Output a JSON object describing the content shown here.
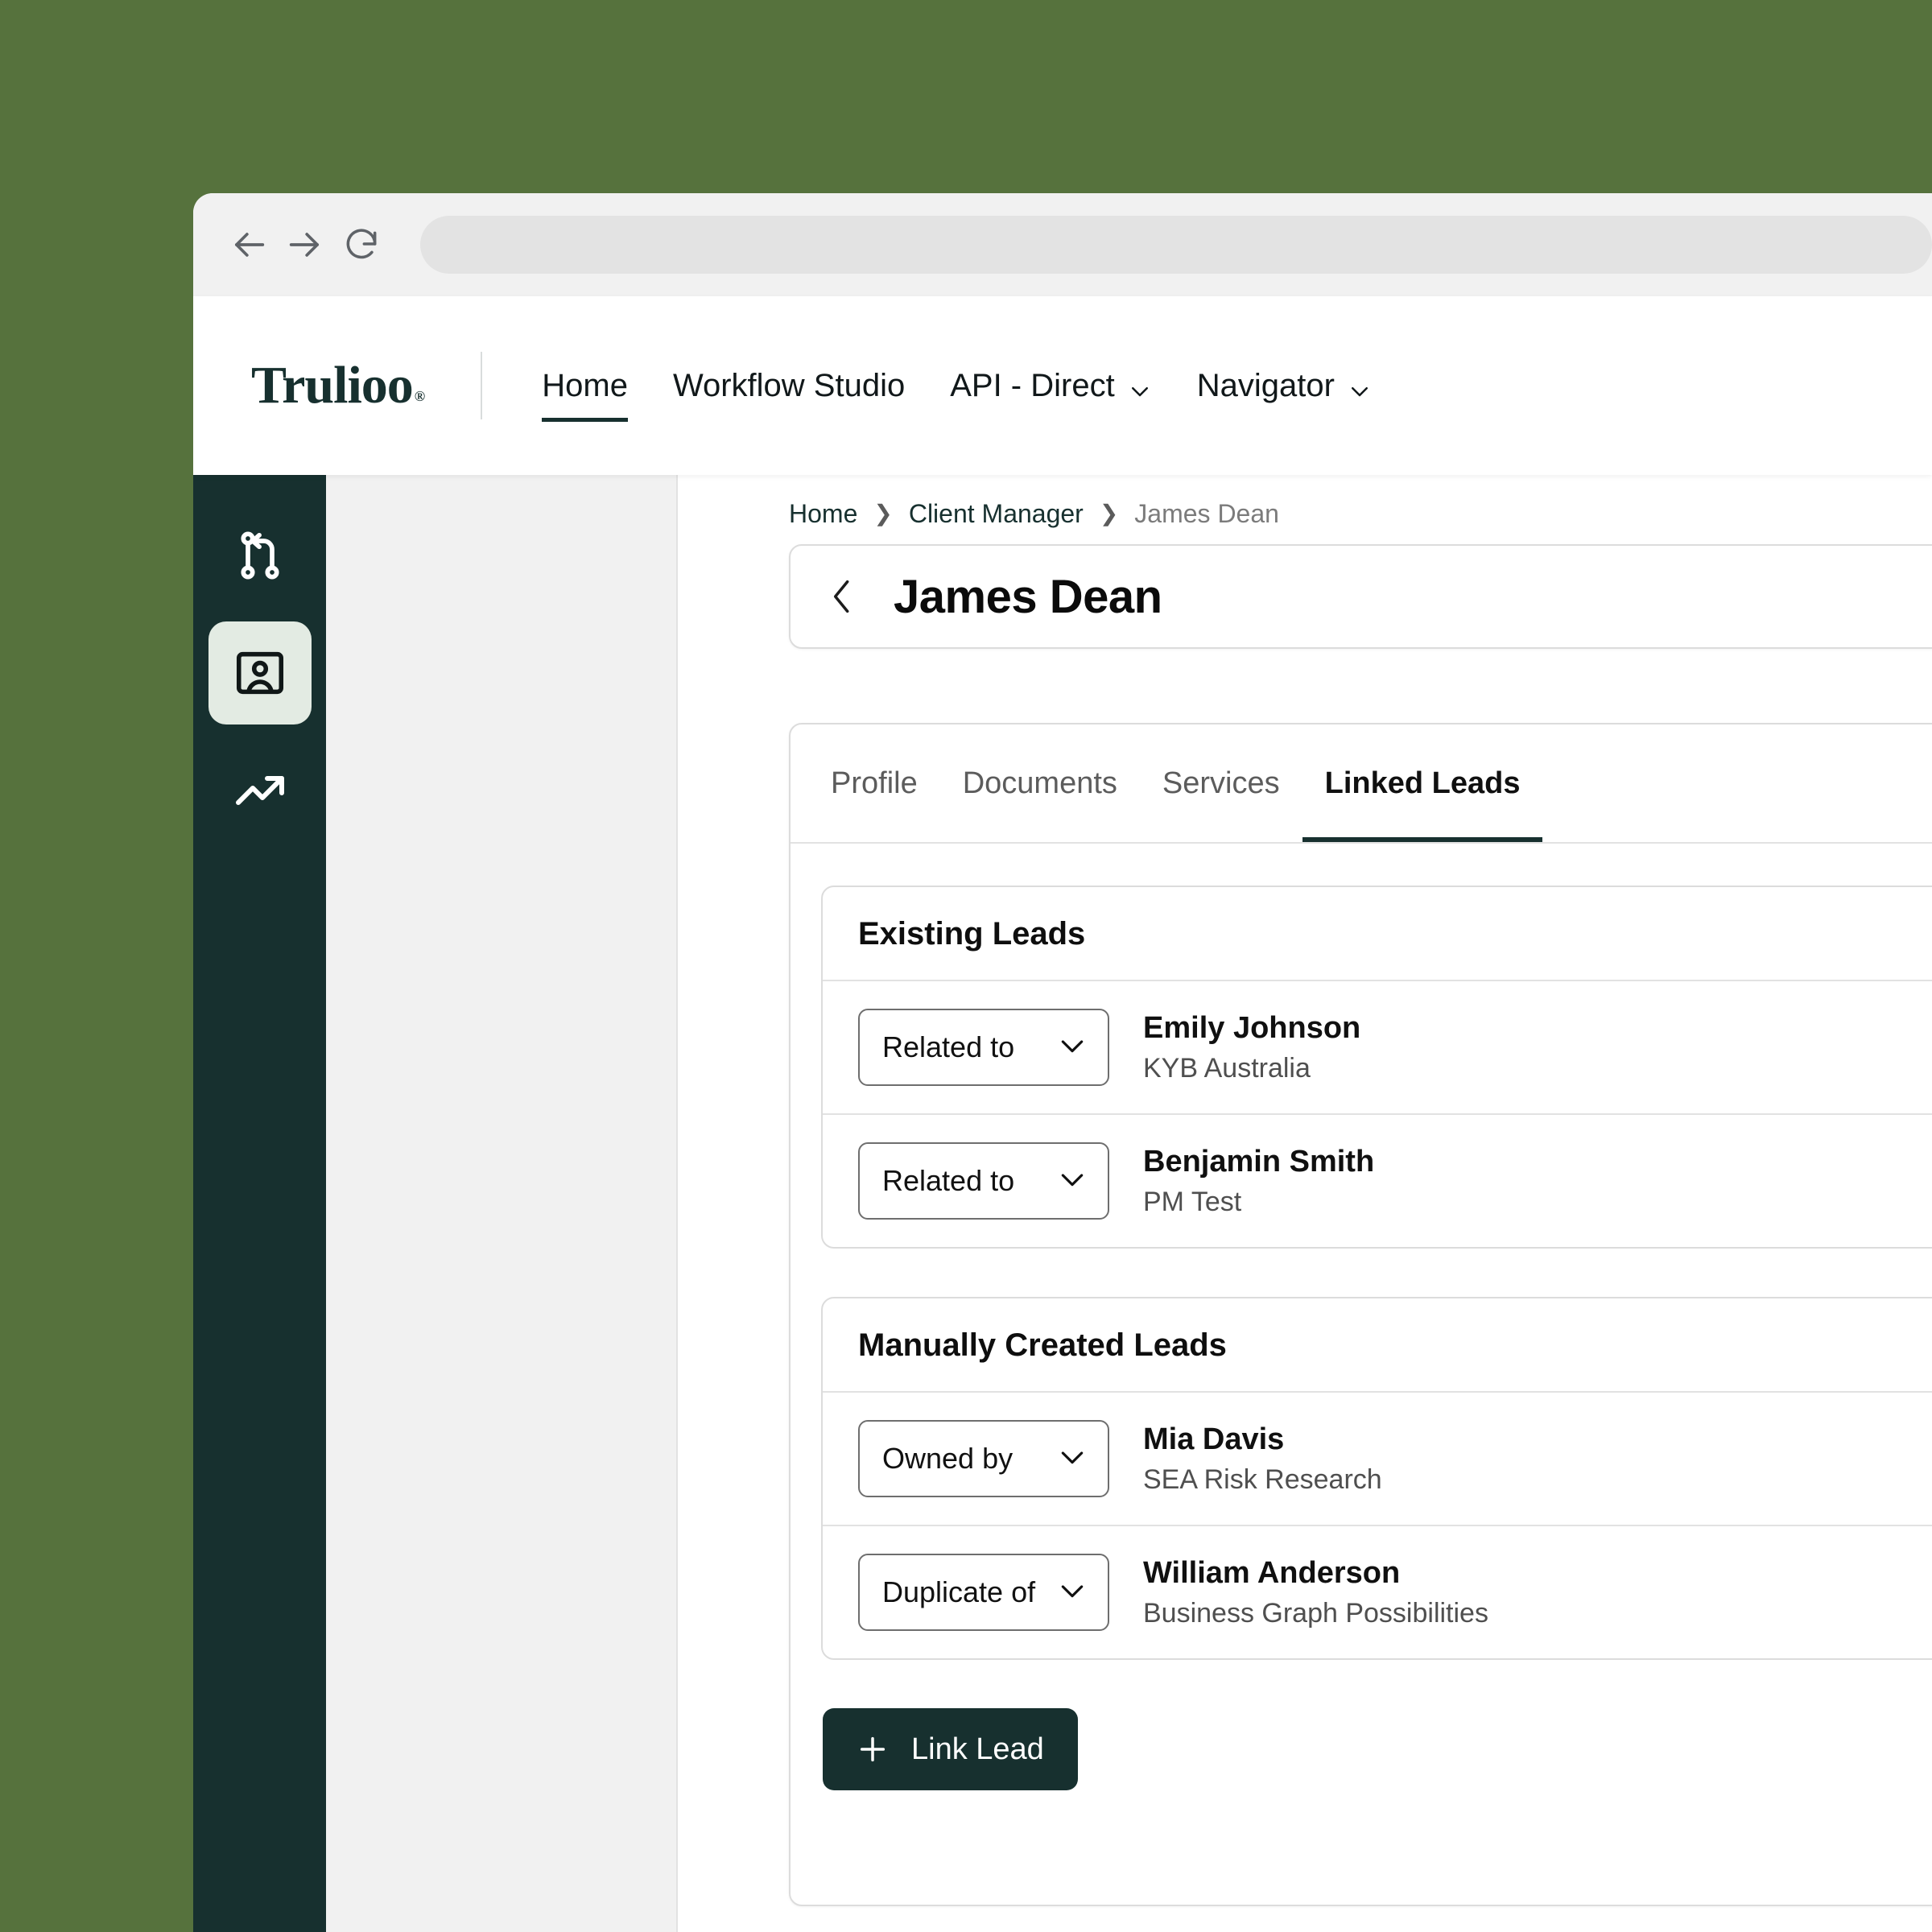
{
  "window": {
    "background_color": "#56723D",
    "chrome": {
      "back_icon": "arrow-left-icon",
      "forward_icon": "arrow-right-icon",
      "reload_icon": "reload-icon",
      "url_value": "",
      "url_placeholder": ""
    }
  },
  "header": {
    "brand": "Trulioo",
    "brand_mark": "®",
    "nav": [
      {
        "label": "Home",
        "active": true,
        "has_dropdown": false
      },
      {
        "label": "Workflow Studio",
        "active": false,
        "has_dropdown": false
      },
      {
        "label": "API - Direct",
        "active": false,
        "has_dropdown": true
      },
      {
        "label": "Navigator",
        "active": false,
        "has_dropdown": true
      }
    ]
  },
  "sidebar": {
    "background_color": "#17302f",
    "active_background_color": "#e3ebe3",
    "items": [
      {
        "icon": "git-branch-icon",
        "active": false
      },
      {
        "icon": "contact-card-icon",
        "active": true
      },
      {
        "icon": "trending-up-icon",
        "active": false
      }
    ]
  },
  "breadcrumb": [
    {
      "label": "Home",
      "current": false
    },
    {
      "label": "Client Manager",
      "current": false
    },
    {
      "label": "James Dean",
      "current": true
    }
  ],
  "title_card": {
    "back_icon": "chevron-left-icon",
    "title": "James Dean"
  },
  "tabs": [
    {
      "label": "Profile",
      "active": false
    },
    {
      "label": "Documents",
      "active": false
    },
    {
      "label": "Services",
      "active": false
    },
    {
      "label": "Linked Leads",
      "active": true
    }
  ],
  "linked_leads": {
    "sections": [
      {
        "title": "Existing Leads",
        "rows": [
          {
            "relation": "Related to",
            "name": "Emily Johnson",
            "org": "KYB Australia"
          },
          {
            "relation": "Related to",
            "name": "Benjamin Smith",
            "org": "PM Test"
          }
        ]
      },
      {
        "title": "Manually Created Leads",
        "rows": [
          {
            "relation": "Owned by",
            "name": "Mia Davis",
            "org": "SEA Risk Research"
          },
          {
            "relation": "Duplicate of",
            "name": "William Anderson",
            "org": "Business Graph Possibilities"
          }
        ]
      }
    ],
    "link_lead_button": {
      "label": "Link Lead",
      "icon": "plus-icon",
      "background_color": "#17302f"
    }
  }
}
